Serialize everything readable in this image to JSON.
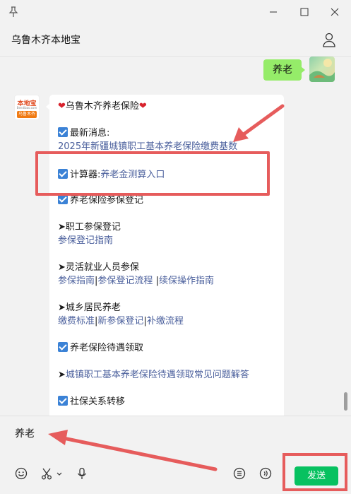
{
  "titlebar": {
    "icons": [
      "pin-icon",
      "minimize-icon",
      "maximize-icon",
      "close-icon"
    ]
  },
  "header": {
    "title": "乌鲁木齐本地宝",
    "profile_icon": "user-icon"
  },
  "messages": {
    "outgoing": {
      "text": "养老"
    },
    "bot": {
      "avatar": {
        "brand_top": "本地宝",
        "brand_sub": "Bendibao.com",
        "brand_bar": "乌鲁木齐"
      },
      "title": "乌鲁木齐养老保险",
      "news_label": "最新消息:",
      "news_link": "2025年新疆城镇职工基本养老保险缴费基数",
      "calc_label": "计算器:",
      "calc_link": "养老金测算入口",
      "register_title": "养老保险参保登记",
      "worker_title": "职工参保登记",
      "worker_link": "参保登记指南",
      "flex_title": "灵活就业人员参保",
      "flex_links": [
        "参保指南",
        "参保登记流程",
        "续保操作指南"
      ],
      "rural_title": "城乡居民养老",
      "rural_links": [
        "缴费标准",
        "新参保登记",
        "补缴流程"
      ],
      "benefit_title": "养老保险待遇领取",
      "benefit_link": "城镇职工基本养老保险待遇领取常见问题解答",
      "transfer_title": "社保关系转移",
      "pipe": "|",
      "arrow": "➤"
    }
  },
  "input": {
    "value": "养老",
    "toolbar_icons": [
      "emoji-icon",
      "scissors-icon",
      "chevron-down-icon",
      "microphone-icon",
      "list-icon",
      "voice-icon"
    ],
    "send_label": "发送"
  },
  "colors": {
    "send_button": "#07c160",
    "my_bubble": "#95ec69",
    "link": "#4a5f9c",
    "annotation": "#e65c5c",
    "checkbox": "#3b82d6"
  }
}
